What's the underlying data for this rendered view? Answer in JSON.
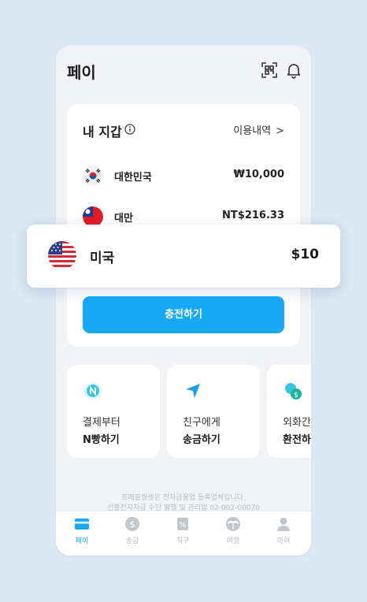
{
  "header": {
    "title": "페이"
  },
  "wallet": {
    "title": "내 지갑",
    "history_label": "이용내역",
    "chevron": ">",
    "currencies": [
      {
        "name": "대한민국",
        "amount": "₩10,000",
        "flag": "kr"
      },
      {
        "name": "대만",
        "amount": "NT$216.33",
        "flag": "tw"
      }
    ],
    "charge_label": "충전하기"
  },
  "highlight": {
    "name": "미국",
    "amount": "$10",
    "flag": "us"
  },
  "features": [
    {
      "sub": "결제부터",
      "main": "N빵하기",
      "icon": "n-circle-icon"
    },
    {
      "sub": "친구에게",
      "main": "송금하기",
      "icon": "send-arrow-icon"
    },
    {
      "sub": "외화간",
      "main": "환전하",
      "icon": "exchange-icon"
    }
  ],
  "footer": {
    "line1": "트래블월렛은 전자금융업 등록업체입니다.",
    "line2": "선불전자지급 수단 발행 및 관리업 02-002-00070"
  },
  "nav": [
    {
      "label": "페이",
      "icon": "card-icon",
      "active": true
    },
    {
      "label": "송금",
      "icon": "dollar-coin-icon",
      "active": false
    },
    {
      "label": "직구",
      "icon": "percent-tag-icon",
      "active": false
    },
    {
      "label": "여행",
      "icon": "palm-tree-icon",
      "active": false
    },
    {
      "label": "마이",
      "icon": "person-icon",
      "active": false
    }
  ],
  "colors": {
    "accent": "#18a9f4",
    "background": "#dce9f5"
  }
}
